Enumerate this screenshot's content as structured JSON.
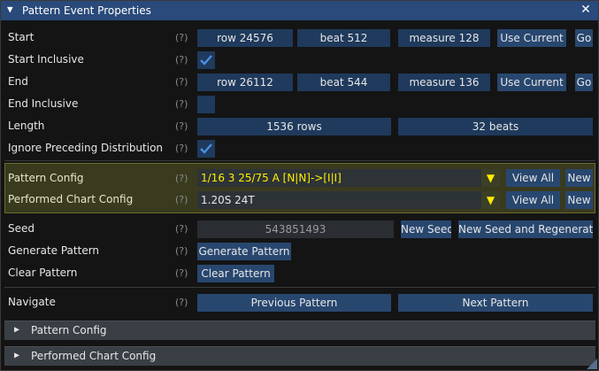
{
  "window": {
    "title": "Pattern Event Properties"
  },
  "help_marker": "(?)",
  "rows": {
    "start": {
      "label": "Start",
      "row": "row 24576",
      "beat": "beat 512",
      "measure": "measure 128",
      "use_current": "Use Current",
      "go": "Go"
    },
    "start_inclusive": {
      "label": "Start Inclusive",
      "checked": true
    },
    "end": {
      "label": "End",
      "row": "row 26112",
      "beat": "beat 544",
      "measure": "measure 136",
      "use_current": "Use Current",
      "go": "Go"
    },
    "end_inclusive": {
      "label": "End Inclusive",
      "checked": false
    },
    "length": {
      "label": "Length",
      "rows": "1536 rows",
      "beats": "32 beats"
    },
    "ignore_preceding": {
      "label": "Ignore Preceding Distribution",
      "checked": true
    },
    "pattern_config": {
      "label": "Pattern Config",
      "value": "1/16 3 25/75 A [N|N]->[I|I]",
      "view_all": "View All",
      "new": "New"
    },
    "performed_chart_config": {
      "label": "Performed Chart Config",
      "value": "1.20S 24T",
      "view_all": "View All",
      "new": "New"
    },
    "seed": {
      "label": "Seed",
      "value": "543851493",
      "new_seed": "New Seed",
      "new_seed_regen": "New Seed and Regenerate"
    },
    "generate_pattern": {
      "label": "Generate Pattern",
      "button": "Generate Pattern"
    },
    "clear_pattern": {
      "label": "Clear Pattern",
      "button": "Clear Pattern"
    },
    "navigate": {
      "label": "Navigate",
      "previous": "Previous Pattern",
      "next": "Next Pattern"
    }
  },
  "sections": {
    "pattern_config": "Pattern Config",
    "performed_chart_config": "Performed Chart Config"
  },
  "colors": {
    "title_bar": "#294a7a",
    "button": "#28476f",
    "highlight_section": "#3a3a1f",
    "accent_yellow": "#ffee00"
  }
}
